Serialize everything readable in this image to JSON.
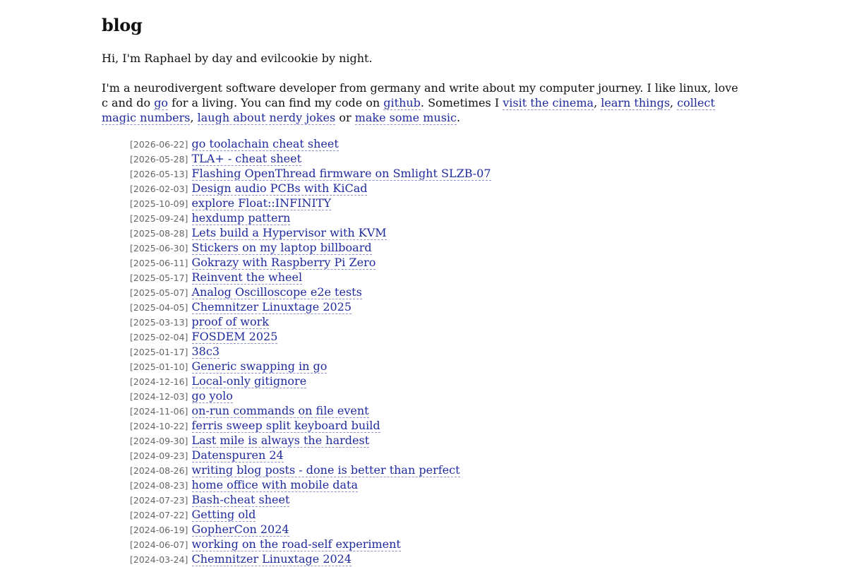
{
  "title": "blog",
  "greeting": "Hi, I'm Raphael by day and evilcookie by night.",
  "about": {
    "text_1": "I'm a neurodivergent software developer from germany and write about my computer journey. I like linux, love c and do ",
    "link_go": "go",
    "text_2": " for a living. You can find my code on ",
    "link_github": "github",
    "text_3": ". Sometimes I ",
    "link_cinema": "visit the cinema",
    "sep_1": ", ",
    "link_learn": "learn things",
    "sep_2": ", ",
    "link_magic": "collect magic numbers",
    "sep_3": ", ",
    "link_laugh": "laugh about nerdy jokes",
    "text_4": " or ",
    "link_music": "make some music",
    "text_5": "."
  },
  "posts": [
    {
      "date": "[2026-06-22]",
      "title": "go toolachain cheat sheet"
    },
    {
      "date": "[2026-05-28]",
      "title": "TLA+ - cheat sheet"
    },
    {
      "date": "[2026-05-13]",
      "title": "Flashing OpenThread firmware on Smlight SLZB-07"
    },
    {
      "date": "[2026-02-03]",
      "title": "Design audio PCBs with KiCad"
    },
    {
      "date": "[2025-10-09]",
      "title": "explore Float::INFINITY"
    },
    {
      "date": "[2025-09-24]",
      "title": "hexdump pattern"
    },
    {
      "date": "[2025-08-28]",
      "title": "Lets build a Hypervisor with KVM"
    },
    {
      "date": "[2025-06-30]",
      "title": "Stickers on my laptop billboard"
    },
    {
      "date": "[2025-06-11]",
      "title": "Gokrazy with Raspberry Pi Zero"
    },
    {
      "date": "[2025-05-17]",
      "title": "Reinvent the wheel"
    },
    {
      "date": "[2025-05-07]",
      "title": "Analog Oscilloscope e2e tests"
    },
    {
      "date": "[2025-04-05]",
      "title": "Chemnitzer Linuxtage 2025"
    },
    {
      "date": "[2025-03-13]",
      "title": "proof of work"
    },
    {
      "date": "[2025-02-04]",
      "title": "FOSDEM 2025"
    },
    {
      "date": "[2025-01-17]",
      "title": "38c3"
    },
    {
      "date": "[2025-01-10]",
      "title": "Generic swapping in go"
    },
    {
      "date": "[2024-12-16]",
      "title": "Local-only gitignore"
    },
    {
      "date": "[2024-12-03]",
      "title": "go yolo"
    },
    {
      "date": "[2024-11-06]",
      "title": "on-run commands on file event"
    },
    {
      "date": "[2024-10-22]",
      "title": "ferris sweep split keyboard build"
    },
    {
      "date": "[2024-09-30]",
      "title": "Last mile is always the hardest"
    },
    {
      "date": "[2024-09-23]",
      "title": "Datenspuren 24"
    },
    {
      "date": "[2024-08-26]",
      "title": "writing blog posts - done is better than perfect"
    },
    {
      "date": "[2024-08-23]",
      "title": "home office with mobile data"
    },
    {
      "date": "[2024-07-23]",
      "title": "Bash-cheat sheet"
    },
    {
      "date": "[2024-07-22]",
      "title": "Getting old"
    },
    {
      "date": "[2024-06-19]",
      "title": "GopherCon 2024"
    },
    {
      "date": "[2024-06-07]",
      "title": "working on the road-self experiment"
    },
    {
      "date": "[2024-03-24]",
      "title": "Chemnitzer Linuxtage 2024"
    }
  ]
}
